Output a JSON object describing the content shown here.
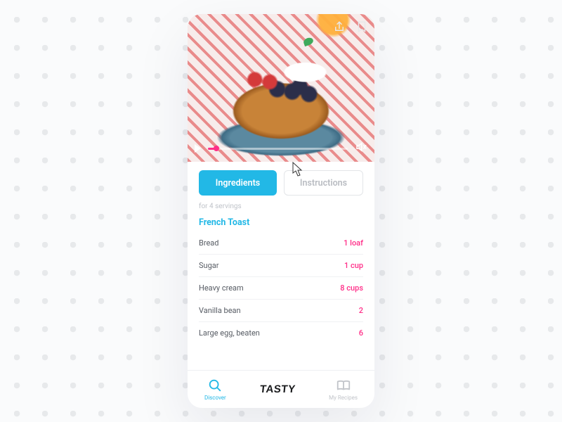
{
  "header": {
    "back_icon": "chevron-left",
    "share_icon": "share",
    "bookmark_icon": "bookmark"
  },
  "video": {
    "play_icon": "play",
    "mute_icon": "volume-muted",
    "progress_pct": 6
  },
  "tabs": [
    {
      "key": "ingredients",
      "label": "Ingredients",
      "active": true
    },
    {
      "key": "instructions",
      "label": "Instructions",
      "active": false
    }
  ],
  "servings_text": "for 4 servings",
  "section_title": "French Toast",
  "ingredients": [
    {
      "name": "Bread",
      "amount": "1 loaf"
    },
    {
      "name": "Sugar",
      "amount": "1 cup"
    },
    {
      "name": "Heavy cream",
      "amount": "8 cups"
    },
    {
      "name": "Vanilla bean",
      "amount": "2"
    },
    {
      "name": "Large egg, beaten",
      "amount": "6"
    }
  ],
  "nav": {
    "discover_label": "Discover",
    "brand": "TASTY",
    "myrecipes_label": "My Recipes"
  }
}
